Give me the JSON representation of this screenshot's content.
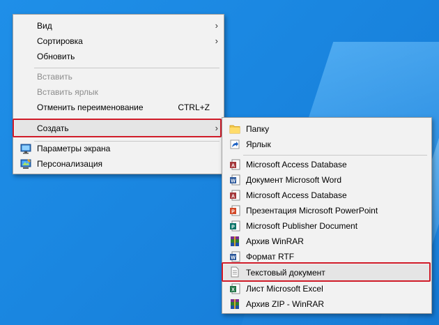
{
  "main_menu": {
    "items": [
      {
        "label": "Вид",
        "has_submenu": true,
        "disabled": false
      },
      {
        "label": "Сортировка",
        "has_submenu": true,
        "disabled": false
      },
      {
        "label": "Обновить",
        "has_submenu": false,
        "disabled": false
      },
      {
        "label": "Вставить",
        "has_submenu": false,
        "disabled": true
      },
      {
        "label": "Вставить ярлык",
        "has_submenu": false,
        "disabled": true
      },
      {
        "label": "Отменить переименование",
        "shortcut": "CTRL+Z",
        "has_submenu": false,
        "disabled": false
      },
      {
        "label": "Создать",
        "has_submenu": true,
        "disabled": false,
        "highlighted": true
      },
      {
        "label": "Параметры экрана",
        "icon": "display-settings-icon",
        "has_submenu": false,
        "disabled": false
      },
      {
        "label": "Персонализация",
        "icon": "personalization-icon",
        "has_submenu": false,
        "disabled": false
      }
    ],
    "arrow_glyph": "›"
  },
  "sub_menu": {
    "items": [
      {
        "label": "Папку",
        "icon": "folder-icon"
      },
      {
        "label": "Ярлык",
        "icon": "shortcut-icon"
      },
      {
        "label": "Microsoft Access Database",
        "icon": "access-icon"
      },
      {
        "label": "Документ Microsoft Word",
        "icon": "word-icon"
      },
      {
        "label": "Microsoft Access Database",
        "icon": "access-icon"
      },
      {
        "label": "Презентация Microsoft PowerPoint",
        "icon": "powerpoint-icon"
      },
      {
        "label": "Microsoft Publisher Document",
        "icon": "publisher-icon"
      },
      {
        "label": "Архив WinRAR",
        "icon": "winrar-icon"
      },
      {
        "label": "Формат RTF",
        "icon": "rtf-icon"
      },
      {
        "label": "Текстовый документ",
        "icon": "text-document-icon",
        "highlighted": true
      },
      {
        "label": "Лист Microsoft Excel",
        "icon": "excel-icon"
      },
      {
        "label": "Архив ZIP - WinRAR",
        "icon": "zip-winrar-icon"
      }
    ]
  },
  "colors": {
    "desktop": "#1a86e0",
    "menu_bg": "#f2f2f2",
    "highlight_border": "#d01b28",
    "disabled_text": "#8d8d8d"
  }
}
